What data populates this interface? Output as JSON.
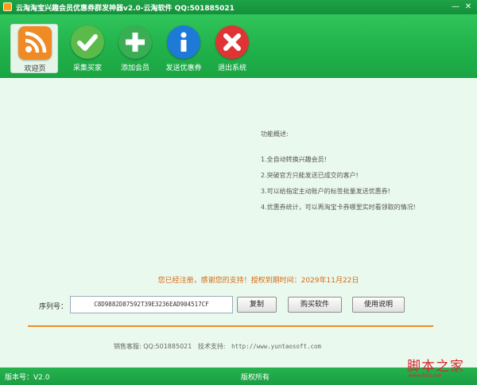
{
  "window": {
    "title": "云淘淘宝兴趣会员优惠券群发神器v2.0-云淘软件 QQ:501885021",
    "minimize_glyph": "—",
    "close_glyph": "✕"
  },
  "toolbar": {
    "items": [
      {
        "label": "欢迎页",
        "icon": "rss-icon",
        "active": true
      },
      {
        "label": "采集买家",
        "icon": "check-icon",
        "active": false
      },
      {
        "label": "添加会员",
        "icon": "plus-icon",
        "active": false
      },
      {
        "label": "发送优惠券",
        "icon": "info-icon",
        "active": false
      },
      {
        "label": "退出系统",
        "icon": "close-icon",
        "active": false
      }
    ]
  },
  "features": {
    "title": "功能概述:",
    "items": [
      "1.全自动转换兴趣会员!",
      "2.突破官方只能发送已成交的客户!",
      "3.可以给指定主动账户的标签批量发送优惠券!",
      "4.优惠券统计，可以再淘宝卡券哪里实时看领取的情况!"
    ]
  },
  "registration": {
    "notice": "您已经注册，感谢您的支持！授权到期时间：2029年11月22日"
  },
  "serial": {
    "label": "序列号：",
    "value": "C8D9882D87592T39E3236EAD904517CF"
  },
  "buttons": {
    "copy": "复制",
    "buy": "购买软件",
    "help": "使用说明"
  },
  "support": {
    "sales": "销售客服: QQ:501885021",
    "tech_label": "技术支持:",
    "url": "http://www.yuntaosoft.com"
  },
  "statusbar": {
    "version": "版本号：V2.0",
    "copyright": "版权所有"
  },
  "watermark": {
    "site_name": "脚本之家",
    "site_url": "www.jb51.net"
  },
  "colors": {
    "brand_green": "#21b24b",
    "accent_orange": "#f08a24",
    "notice_orange": "#d86a10"
  }
}
